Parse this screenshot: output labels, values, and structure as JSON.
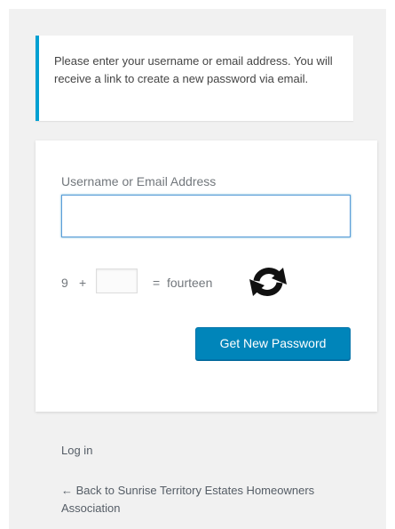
{
  "message": {
    "text": "Please enter your username or email address. You will receive a link to create a new password via email."
  },
  "form": {
    "username_label": "Username or Email Address",
    "username_value": "",
    "captcha": {
      "number": "9",
      "operator": "+",
      "answer_value": "",
      "equals": "=",
      "result_word": "fourteen"
    },
    "refresh_icon": "refresh-icon",
    "submit_label": "Get New Password"
  },
  "nav": {
    "login_label": "Log in",
    "back_label": "← Back to Sunrise Territory Estates Homeowners Association"
  },
  "colors": {
    "accent": "#00a0d2",
    "button": "#0085ba",
    "background": "#f1f1f1"
  }
}
